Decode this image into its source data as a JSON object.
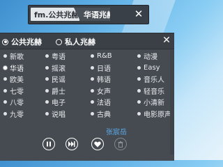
{
  "player": {
    "station_name": "fm.公共兆赫",
    "current_channel": "华语兆赫",
    "close_label": "✕"
  },
  "tabs": [
    {
      "label": "公共兆赫",
      "active": true
    },
    {
      "label": "私人兆赫",
      "active": false
    }
  ],
  "panel_close_label": "✕",
  "channels": [
    [
      "新歌",
      "粤语",
      "R&B",
      "动漫"
    ],
    [
      "华语",
      "摇滚",
      "日语",
      "Easy"
    ],
    [
      "欧美",
      "民谣",
      "韩语",
      "音乐人"
    ],
    [
      "七零",
      "爵士",
      "女声",
      "轻音乐"
    ],
    [
      "八零",
      "电子",
      "法语",
      "小清新"
    ],
    [
      "九零",
      "说唱",
      "古典",
      "电影原声"
    ]
  ],
  "selected_channel": "华语",
  "author": "张宸岳",
  "controls": [
    {
      "icon": "pause-icon",
      "enabled": true
    },
    {
      "icon": "next-icon",
      "enabled": true
    },
    {
      "icon": "heart-icon",
      "enabled": true
    },
    {
      "icon": "trash-icon",
      "enabled": false
    }
  ],
  "colors": {
    "panel_bg": "#454b51",
    "bar_bg": "#3a4047",
    "author_link": "#5ba8e6"
  }
}
